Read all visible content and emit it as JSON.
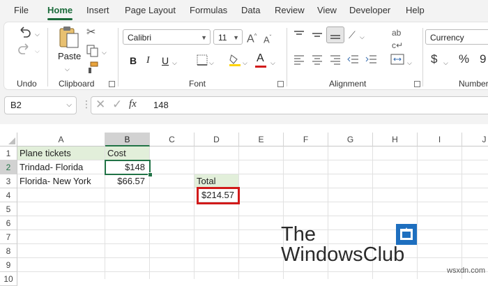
{
  "menu": {
    "items": [
      "File",
      "Home",
      "Insert",
      "Page Layout",
      "Formulas",
      "Data",
      "Review",
      "View",
      "Developer",
      "Help"
    ],
    "active": "Home"
  },
  "ribbon": {
    "groups": {
      "undo": "Undo",
      "clipboard": "Clipboard",
      "font": "Font",
      "alignment": "Alignment",
      "number": "Number"
    },
    "paste_label": "Paste",
    "font_name": "Calibri",
    "font_size": "11",
    "number_format": "Currency",
    "bold": "B",
    "italic": "I",
    "underline": "U",
    "font_color_letter": "A",
    "grow_font": "A",
    "shrink_font": "A",
    "currency_symbol": "$",
    "percent_symbol": "%",
    "comma_symbol": "9",
    "wrap_label": "ab",
    "wrap_label2": "c"
  },
  "formula_bar": {
    "name_box": "B2",
    "fx_label": "fx",
    "value": "148"
  },
  "grid": {
    "columns": [
      "A",
      "B",
      "C",
      "D",
      "E",
      "F",
      "G",
      "H",
      "I",
      "J"
    ],
    "rows": [
      "1",
      "2",
      "3",
      "4",
      "5",
      "6",
      "7",
      "8",
      "9",
      "10"
    ],
    "cells": {
      "A1": "Plane tickets",
      "B1": "Cost",
      "A2": "Trindad- Florida",
      "B2": "$148",
      "A3": "Florida- New York",
      "B3": "$66.57",
      "D3": "Total",
      "D4": "$214.57"
    }
  },
  "watermark": {
    "line1": "The",
    "line2": "WindowsClub",
    "site": "wsxdn.com"
  },
  "colors": {
    "excel_green": "#217346",
    "header_highlight": "#e2efda",
    "annotation_red": "#d11a1a"
  }
}
